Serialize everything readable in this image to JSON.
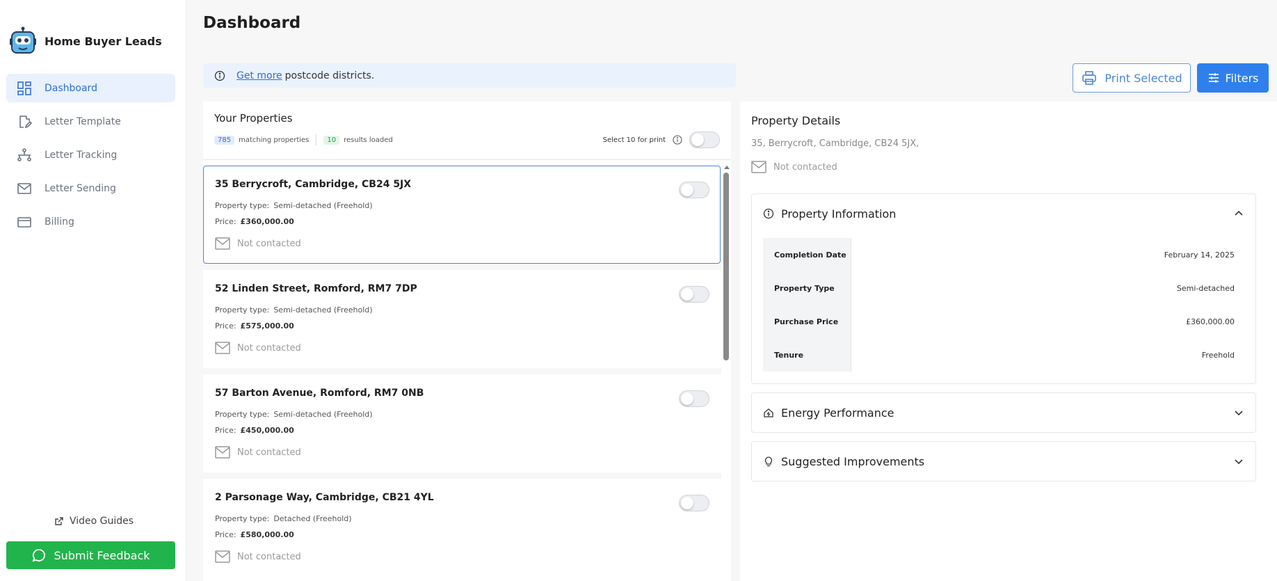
{
  "app": {
    "name": "Home Buyer Leads"
  },
  "sidebar": {
    "items": [
      {
        "label": "Dashboard",
        "icon": "dashboard-icon",
        "active": true
      },
      {
        "label": "Letter Template",
        "icon": "edit-document-icon"
      },
      {
        "label": "Letter Tracking",
        "icon": "tracking-icon"
      },
      {
        "label": "Letter Sending",
        "icon": "mail-icon"
      },
      {
        "label": "Billing",
        "icon": "credit-card-icon"
      }
    ],
    "video_guides": "Video Guides",
    "feedback": "Submit Feedback"
  },
  "header": {
    "title": "Dashboard",
    "banner_link": "Get more",
    "banner_text": "postcode districts.",
    "print_selected": "Print Selected",
    "filters": "Filters"
  },
  "properties": {
    "title": "Your Properties",
    "matching_count": "785",
    "matching_label": "matching properties",
    "loaded_count": "10",
    "loaded_label": "results loaded",
    "select_label": "Select 10 for print",
    "list": [
      {
        "address": "35 Berrycroft, Cambridge, CB24 5JX",
        "type_label": "Property type:",
        "type": "Semi-detached (Freehold)",
        "price_label": "Price:",
        "price": "£360,000.00",
        "status": "Not contacted"
      },
      {
        "address": "52 Linden Street, Romford, RM7 7DP",
        "type_label": "Property type:",
        "type": "Semi-detached (Freehold)",
        "price_label": "Price:",
        "price": "£575,000.00",
        "status": "Not contacted"
      },
      {
        "address": "57 Barton Avenue, Romford, RM7 0NB",
        "type_label": "Property type:",
        "type": "Semi-detached (Freehold)",
        "price_label": "Price:",
        "price": "£450,000.00",
        "status": "Not contacted"
      },
      {
        "address": "2 Parsonage Way, Cambridge, CB21 4YL",
        "type_label": "Property type:",
        "type": "Detached (Freehold)",
        "price_label": "Price:",
        "price": "£580,000.00",
        "status": "Not contacted"
      }
    ]
  },
  "details": {
    "title": "Property Details",
    "address": "35, Berrycroft, Cambridge, CB24 5JX,",
    "status": "Not contacted",
    "info_title": "Property Information",
    "info_rows": [
      {
        "key": "Completion Date",
        "value": "February 14, 2025"
      },
      {
        "key": "Property Type",
        "value": "Semi-detached"
      },
      {
        "key": "Purchase Price",
        "value": "£360,000.00"
      },
      {
        "key": "Tenure",
        "value": "Freehold"
      }
    ],
    "energy_title": "Energy Performance",
    "improvements_title": "Suggested Improvements"
  },
  "colors": {
    "accent": "#2f80ed",
    "active_nav_bg": "#e8f1fd",
    "feedback_green": "#22b44c",
    "banner_bg": "#eaf2fd"
  }
}
